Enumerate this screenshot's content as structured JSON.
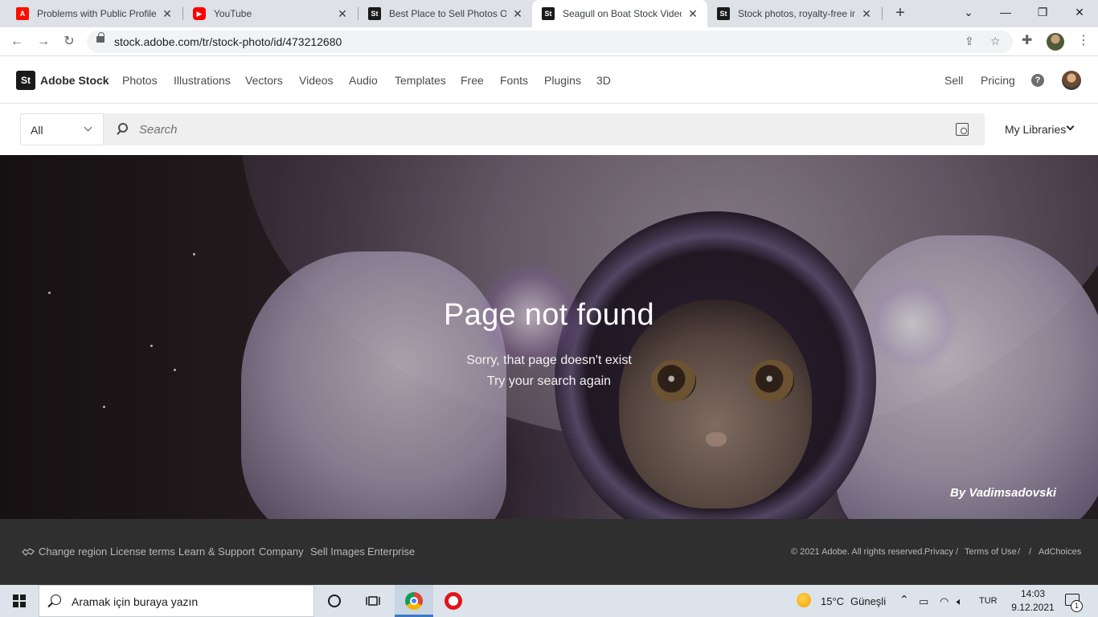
{
  "browser": {
    "tabs": [
      {
        "title": "Problems with Public Profile",
        "favicon": "adobe-icon"
      },
      {
        "title": "YouTube",
        "favicon": "youtube-icon"
      },
      {
        "title": "Best Place to Sell Photos Onl",
        "favicon": "adobe-stock-icon"
      },
      {
        "title": "Seagull on Boat Stock Video",
        "favicon": "adobe-stock-icon",
        "active": true
      },
      {
        "title": "Stock photos, royalty-free im",
        "favicon": "adobe-stock-icon"
      }
    ],
    "url": "stock.adobe.com/tr/stock-photo/id/473212680"
  },
  "header": {
    "logo_text": "St",
    "brand": "Adobe Stock",
    "nav": [
      "Photos",
      "Illustrations",
      "Vectors",
      "Videos",
      "Audio",
      "Templates",
      "Free",
      "Fonts",
      "Plugins",
      "3D"
    ],
    "sell": "Sell",
    "pricing": "Pricing",
    "help": "?"
  },
  "search": {
    "scope": "All",
    "placeholder": "Search",
    "my_libraries": "My Libraries"
  },
  "hero": {
    "title": "Page not found",
    "line1": "Sorry, that page doesn't exist",
    "line2": "Try your search again",
    "credit": "By Vadimsadovski"
  },
  "footer": {
    "links": [
      "Change region",
      "License terms",
      "Learn & Support",
      "Company",
      "Sell Images",
      "Enterprise"
    ],
    "copyright": "© 2021 Adobe. All rights reserved.",
    "privacy": "Privacy",
    "terms": "Terms of Use",
    "adchoices": "AdChoices",
    "sep": "/"
  },
  "taskbar": {
    "search_placeholder": "Aramak için buraya yazın",
    "weather_temp": "15°C",
    "weather_desc": "Güneşli",
    "lang": "TUR",
    "time": "14:03",
    "date": "9.12.2021",
    "notif_count": "1"
  },
  "colors": {
    "adobe_red": "#fa0f00",
    "youtube_red": "#ff0000",
    "footer_bg": "#2f2f2f",
    "tabstrip_bg": "#dee1e6"
  }
}
